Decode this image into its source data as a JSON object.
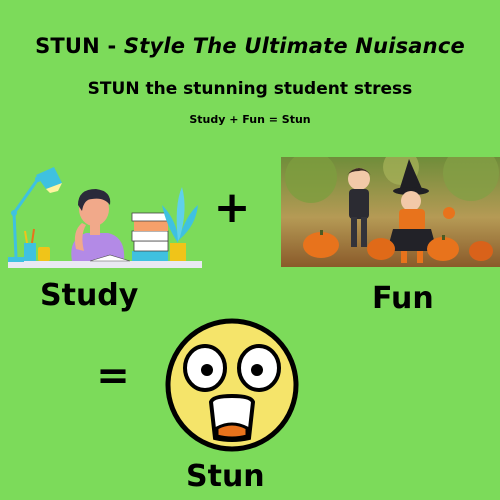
{
  "title": {
    "prefix": "STUN - ",
    "emphasis": "Style The Ultimate Nuisance"
  },
  "subtitle": "STUN the stunning student stress",
  "formula": "Study + Fun = Stun",
  "symbols": {
    "plus": "+",
    "equals": "="
  },
  "labels": {
    "study": "Study",
    "fun": "Fun",
    "stun": "Stun"
  },
  "illustrations": {
    "study": "person-studying-at-desk-icon",
    "fun": "children-halloween-pumpkins-photo",
    "stun": "shocked-face-emoji-icon"
  },
  "colors": {
    "background": "#7cdb5a",
    "face": "#f5e46a",
    "shirt": "#b38ae6",
    "lamp": "#3fc1e0",
    "pumpkin": "#e8731c"
  }
}
